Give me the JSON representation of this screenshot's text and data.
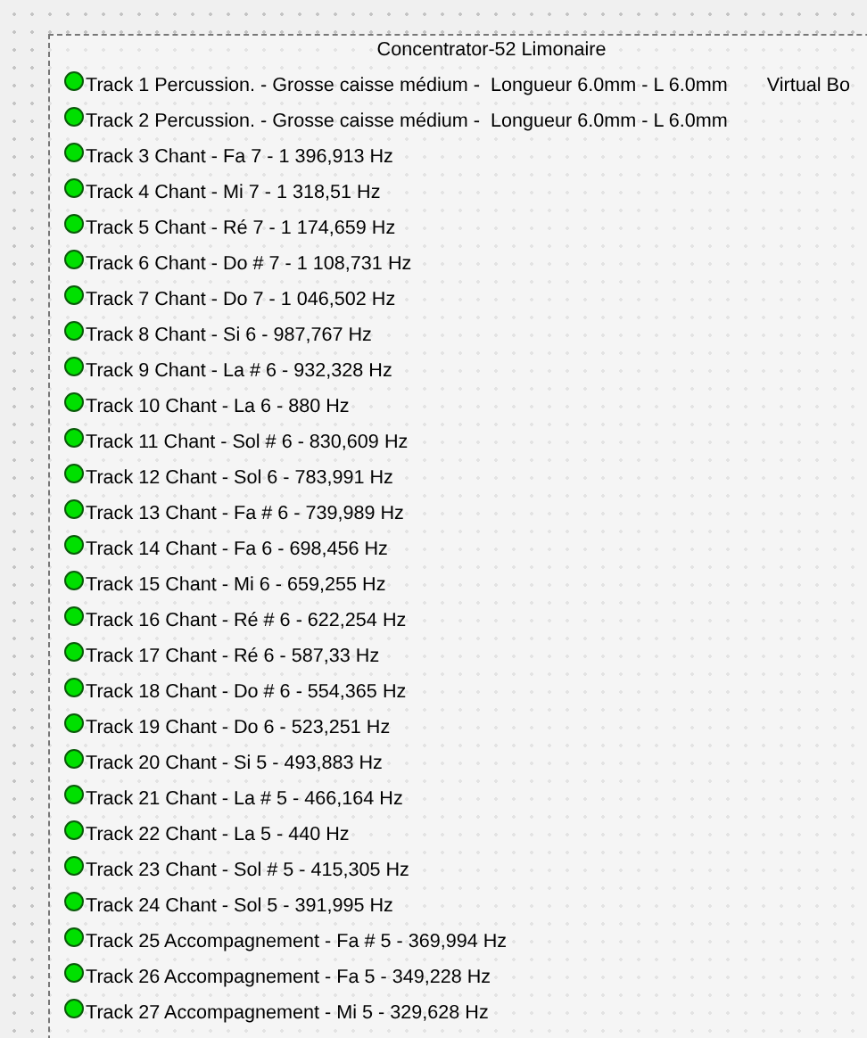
{
  "panel": {
    "title": "Concentrator-52 Limonaire",
    "side_label": "Virtual Bo",
    "tracks": [
      {
        "label": "Track 1 Percussion. - Grosse caisse médium -  Longueur 6.0mm - L 6.0mm",
        "on": true
      },
      {
        "label": "Track 2 Percussion. - Grosse caisse médium -  Longueur 6.0mm - L 6.0mm",
        "on": true
      },
      {
        "label": "Track 3 Chant - Fa 7 - 1 396,913 Hz",
        "on": true
      },
      {
        "label": "Track 4 Chant - Mi 7 - 1 318,51 Hz",
        "on": true
      },
      {
        "label": "Track 5 Chant - Ré 7 - 1 174,659 Hz",
        "on": true
      },
      {
        "label": "Track 6 Chant - Do # 7 - 1 108,731 Hz",
        "on": true
      },
      {
        "label": "Track 7 Chant - Do 7 - 1 046,502 Hz",
        "on": true
      },
      {
        "label": "Track 8 Chant - Si 6 - 987,767 Hz",
        "on": true
      },
      {
        "label": "Track 9 Chant - La # 6 - 932,328 Hz",
        "on": true
      },
      {
        "label": "Track 10 Chant - La 6 - 880 Hz",
        "on": true
      },
      {
        "label": "Track 11 Chant - Sol # 6 - 830,609 Hz",
        "on": true
      },
      {
        "label": "Track 12 Chant - Sol 6 - 783,991 Hz",
        "on": true
      },
      {
        "label": "Track 13 Chant - Fa # 6 - 739,989 Hz",
        "on": true
      },
      {
        "label": "Track 14 Chant - Fa 6 - 698,456 Hz",
        "on": true
      },
      {
        "label": "Track 15 Chant - Mi 6 - 659,255 Hz",
        "on": true
      },
      {
        "label": "Track 16 Chant - Ré # 6 - 622,254 Hz",
        "on": true
      },
      {
        "label": "Track 17 Chant - Ré 6 - 587,33 Hz",
        "on": true
      },
      {
        "label": "Track 18 Chant - Do # 6 - 554,365 Hz",
        "on": true
      },
      {
        "label": "Track 19 Chant - Do 6 - 523,251 Hz",
        "on": true
      },
      {
        "label": "Track 20 Chant - Si 5 - 493,883 Hz",
        "on": true
      },
      {
        "label": "Track 21 Chant - La # 5 - 466,164 Hz",
        "on": true
      },
      {
        "label": "Track 22 Chant - La 5 - 440 Hz",
        "on": true
      },
      {
        "label": "Track 23 Chant - Sol # 5 - 415,305 Hz",
        "on": true
      },
      {
        "label": "Track 24 Chant - Sol 5 - 391,995 Hz",
        "on": true
      },
      {
        "label": "Track 25 Accompagnement - Fa # 5 - 369,994 Hz",
        "on": true
      },
      {
        "label": "Track 26 Accompagnement - Fa 5 - 349,228 Hz",
        "on": true
      },
      {
        "label": "Track 27 Accompagnement - Mi 5 - 329,628 Hz",
        "on": true
      }
    ]
  }
}
